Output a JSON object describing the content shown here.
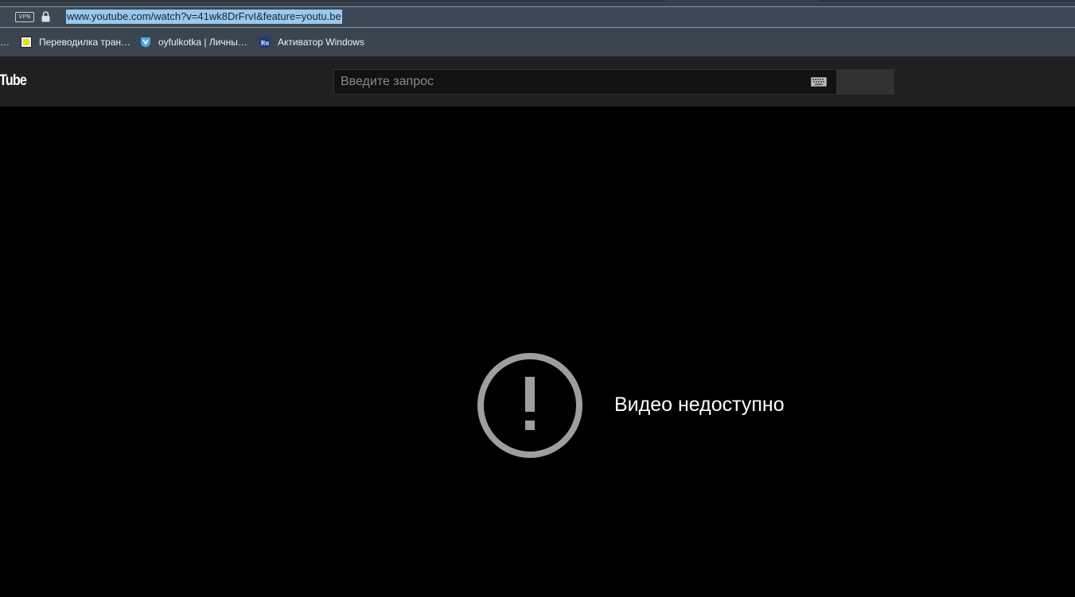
{
  "browser": {
    "vpn_label": "VPN",
    "url": "www.youtube.com/watch?v=41wk8DrFrvI&feature=youtu.be",
    "bookmarks": {
      "overflow": "…",
      "items": [
        {
          "label": "Переводилка тран…",
          "icon": "yellow-square-icon"
        },
        {
          "label": "oyfulkotka | Личны…",
          "icon": "fox-shield-icon"
        },
        {
          "label": "Активатор Windows",
          "icon": "ru-badge-icon"
        }
      ]
    }
  },
  "youtube": {
    "logo_partial": "Tube",
    "search": {
      "placeholder": "Введите запрос",
      "value": ""
    },
    "player": {
      "error_message": "Видео недоступно",
      "error_icon": "exclamation-circle-icon"
    }
  },
  "colors": {
    "chrome_bg": "#3c4853",
    "url_highlight": "#99c9ef",
    "header_bg": "#202020",
    "player_bg": "#000000",
    "error_icon": "#9e9e9e"
  }
}
